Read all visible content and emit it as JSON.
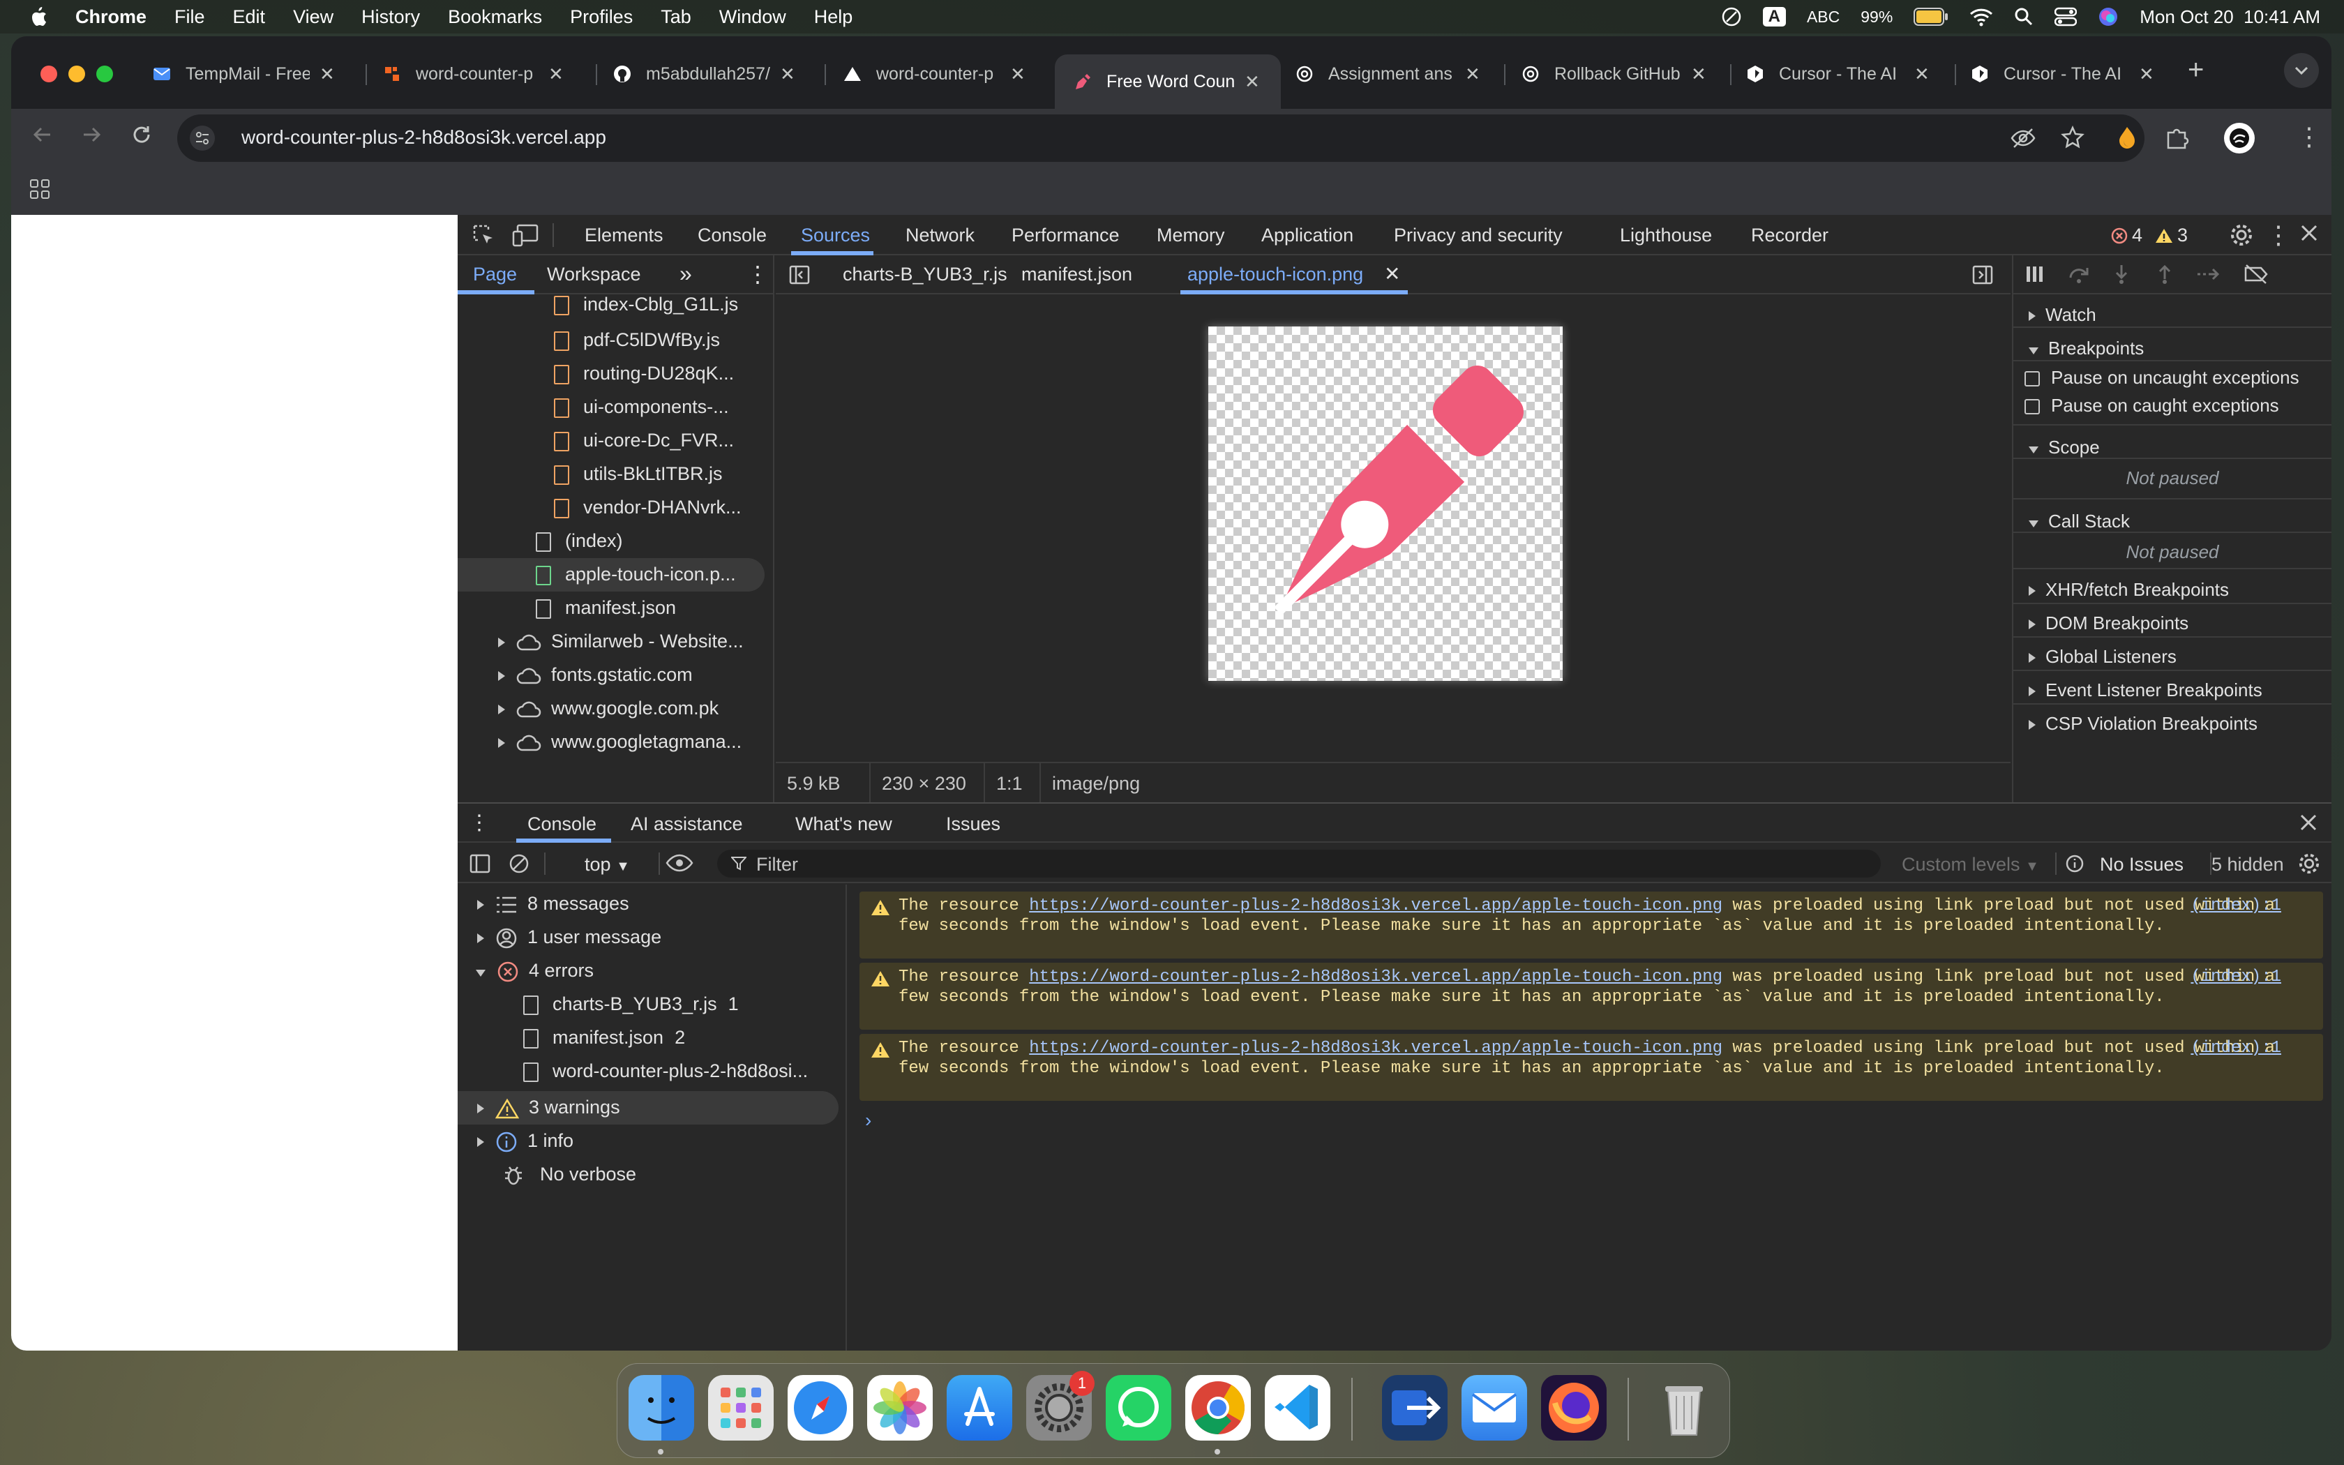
{
  "menubar": {
    "apple": "",
    "app": "Chrome",
    "items": [
      "File",
      "Edit",
      "View",
      "History",
      "Bookmarks",
      "Profiles",
      "Tab",
      "Window",
      "Help"
    ],
    "input_badge": "A",
    "input_source": "ABC",
    "battery": "99%",
    "datetime": "Mon Oct 20  10:41 AM"
  },
  "tabs": [
    {
      "title": "TempMail - Free",
      "icon": "mail-icon",
      "color": "#4a8ff7"
    },
    {
      "title": "word-counter-p",
      "icon": "vercel-orange-icon",
      "color": "#f26522"
    },
    {
      "title": "m5abdullah257/",
      "icon": "github-icon",
      "color": "#ffffff"
    },
    {
      "title": "word-counter-p",
      "icon": "vercel-icon",
      "color": "#ffffff"
    },
    {
      "title": "Free Word Coun",
      "icon": "pen-icon",
      "color": "#ef5b7a",
      "active": true
    },
    {
      "title": "Assignment ans",
      "icon": "openai-icon",
      "color": "#ffffff"
    },
    {
      "title": "Rollback GitHub",
      "icon": "openai-icon",
      "color": "#ffffff"
    },
    {
      "title": "Cursor - The AI",
      "icon": "cursor-icon",
      "color": "#ffffff"
    },
    {
      "title": "Cursor - The AI",
      "icon": "cursor-icon",
      "color": "#ffffff"
    }
  ],
  "address": {
    "url": "word-counter-plus-2-h8d8osi3k.vercel.app"
  },
  "devtools": {
    "panels": [
      "Elements",
      "Console",
      "Sources",
      "Network",
      "Performance",
      "Memory",
      "Application",
      "Privacy and security",
      "Lighthouse",
      "Recorder"
    ],
    "active_panel": "Sources",
    "error_count": "4",
    "warning_count": "3",
    "nav_tabs": [
      "Page",
      "Workspace"
    ],
    "editor_tabs": [
      "charts-B_YUB3_r.js",
      "manifest.json",
      "apple-touch-icon.png"
    ],
    "files": [
      "index-Cblg_G1L.js",
      "pdf-C5lDWfBy.js",
      "routing-DU28qK...",
      "ui-components-...",
      "ui-core-Dc_FVR...",
      "utils-BkLtITBR.js",
      "vendor-DHANvrk...",
      "(index)",
      "apple-touch-icon.p...",
      "manifest.json"
    ],
    "domains": [
      "Similarweb - Website...",
      "fonts.gstatic.com",
      "www.google.com.pk",
      "www.googletagmana..."
    ],
    "image_info": {
      "size": "5.9 kB",
      "dimensions": "230 × 230",
      "ratio": "1:1",
      "mime": "image/png"
    },
    "debugger": {
      "watch": "Watch",
      "breakpoints": "Breakpoints",
      "pause_uncaught": "Pause on uncaught exceptions",
      "pause_caught": "Pause on caught exceptions",
      "scope": "Scope",
      "not_paused": "Not paused",
      "call_stack": "Call Stack",
      "more": [
        "XHR/fetch Breakpoints",
        "DOM Breakpoints",
        "Global Listeners",
        "Event Listener Breakpoints",
        "CSP Violation Breakpoints"
      ]
    },
    "drawer_tabs": [
      "Console",
      "AI assistance",
      "What's new",
      "Issues"
    ],
    "console": {
      "context": "top",
      "filter_placeholder": "Filter",
      "levels": "Custom levels",
      "issues": "No Issues",
      "hidden": "5 hidden",
      "sidebar": {
        "messages": "8 messages",
        "user": "1 user message",
        "errors": "4 errors",
        "error_files": [
          {
            "name": "charts-B_YUB3_r.js",
            "count": "1"
          },
          {
            "name": "manifest.json",
            "count": "2"
          },
          {
            "name": "word-counter-plus-2-h8d8osi...",
            "count": ""
          }
        ],
        "warnings": "3 warnings",
        "info": "1 info",
        "verbose": "No verbose"
      },
      "warning_text_pre": "The resource ",
      "warning_link": "https://word-counter-plus-2-h8d8osi3k.vercel.app/apple-touch-icon.png",
      "warning_text_post": " was preloaded using link preload but not used within a few seconds from the window's load event. Please make sure it has an appropriate `as` value and it is preloaded intentionally.",
      "warning_source": "(index):1",
      "warning_repeat": 3
    }
  },
  "dock": {
    "settings_badge": "1"
  }
}
